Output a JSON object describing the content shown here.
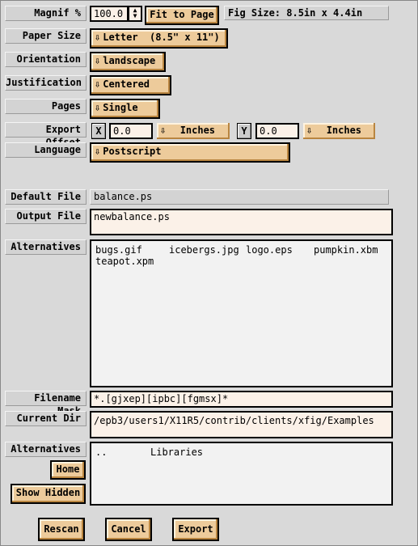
{
  "magnif": {
    "label": "Magnif %",
    "value": "100.0",
    "fit_button": "Fit to Page",
    "fig_size": "Fig Size: 8.5in x 4.4in"
  },
  "paper_size": {
    "label": "Paper Size",
    "value": "Letter  (8.5\" x 11\")"
  },
  "orientation": {
    "label": "Orientation",
    "value": "landscape"
  },
  "justification": {
    "label": "Justification",
    "value": "Centered"
  },
  "pages": {
    "label": "Pages",
    "value": "Single"
  },
  "export_offset": {
    "label": "Export Offset",
    "x_label": "X",
    "x_value": "0.0",
    "x_units": "Inches",
    "y_label": "Y",
    "y_value": "0.0",
    "y_units": "Inches"
  },
  "language": {
    "label": "Language",
    "value": "Postscript"
  },
  "default_file": {
    "label": "Default File",
    "value": "balance.ps"
  },
  "output_file": {
    "label": "Output File",
    "value": "newbalance.ps"
  },
  "file_alternatives": {
    "label": "Alternatives",
    "items": [
      "bugs.gif",
      "icebergs.jpg",
      "logo.eps",
      "pumpkin.xbm",
      "teapot.xpm"
    ]
  },
  "filename_mask": {
    "label": "Filename Mask",
    "value": "*.[gjxep][ipbc][fgmsx]*"
  },
  "current_dir": {
    "label": "Current Dir",
    "value": "/epb3/users1/X11R5/contrib/clients/xfig/Examples"
  },
  "dir_alternatives": {
    "label": "Alternatives",
    "items": [
      "..",
      "Libraries"
    ],
    "home": "Home",
    "show_hidden": "Show Hidden"
  },
  "actions": {
    "rescan": "Rescan",
    "cancel": "Cancel",
    "export": "Export"
  },
  "icons": {
    "menu_arrow": "down-arrow-icon"
  }
}
